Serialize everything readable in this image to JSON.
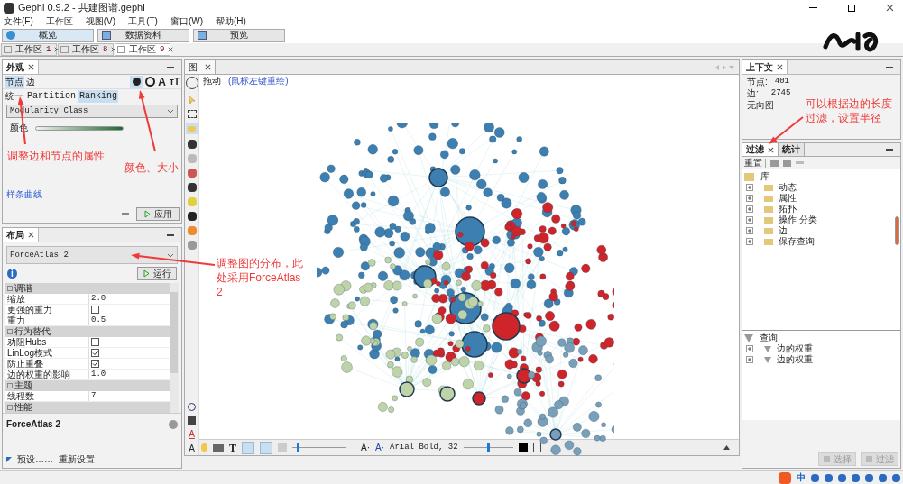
{
  "window": {
    "title": "Gephi 0.9.2 - 共建图谱.gephi"
  },
  "menu": [
    "文件(F)",
    "工作区",
    "视图(V)",
    "工具(T)",
    "窗口(W)",
    "帮助(H)"
  ],
  "modes": [
    {
      "label": "概览",
      "selected": true
    },
    {
      "label": "数据资料",
      "selected": false
    },
    {
      "label": "预览",
      "selected": false
    }
  ],
  "workspace_tabs": [
    {
      "label": "工作区",
      "number": "1",
      "selected": false
    },
    {
      "label": "工作区",
      "number": "8",
      "selected": false
    },
    {
      "label": "工作区",
      "number": "9",
      "selected": true
    }
  ],
  "appearance": {
    "title": "外观",
    "tabs": [
      {
        "label": "节点",
        "selected": true
      },
      {
        "label": "边",
        "selected": false
      }
    ],
    "label_color_glyph": "A",
    "label_size_glyph": "тT",
    "modes": [
      {
        "label": "统一",
        "selected": false
      },
      {
        "label": "Partition",
        "selected": false
      },
      {
        "label": "Ranking",
        "selected": true
      }
    ],
    "attribute": "Modularity Class",
    "color_label": "颜色",
    "spline_link": "样条曲线",
    "apply": "应用"
  },
  "layout": {
    "title": "布局",
    "algorithm": "ForceAtlas 2",
    "info_glyph": "i",
    "run": "运行",
    "sections": [
      {
        "title": "调谐",
        "rows": [
          {
            "kind": "text",
            "label": "缩放",
            "value": "2.0"
          },
          {
            "kind": "check",
            "label": "更强的重力",
            "checked": false
          },
          {
            "kind": "text",
            "label": "重力",
            "value": "0.5"
          }
        ]
      },
      {
        "title": "行为替代",
        "rows": [
          {
            "kind": "check",
            "label": "劝阻Hubs",
            "checked": false
          },
          {
            "kind": "check",
            "label": "LinLog模式",
            "checked": true
          },
          {
            "kind": "check",
            "label": "防止重叠",
            "checked": true
          },
          {
            "kind": "text",
            "label": "边的权重的影响",
            "value": "1.0"
          }
        ]
      },
      {
        "title": "主题",
        "rows": [
          {
            "kind": "text",
            "label": "线程数",
            "value": "7"
          }
        ]
      },
      {
        "title": "性能"
      }
    ],
    "description": "ForceAtlas 2",
    "presets": "预设……",
    "reset": "重新设置"
  },
  "graph": {
    "title": "图",
    "tool_label": "拖动",
    "tool_hint": "(鼠标左键重绘)",
    "side_glyphs": [
      "A",
      "A"
    ],
    "text_glyph": "T",
    "edge_scale": {
      "level": 0.1
    },
    "font_glyphs": [
      "A·",
      "A·"
    ],
    "font": "Arial Bold, 32",
    "label_size": {
      "level": 0.5
    }
  },
  "context": {
    "title": "上下文",
    "nodes_label": "节点:",
    "nodes": "401",
    "edges_label": "边:",
    "edges": "2745",
    "type": "无向图"
  },
  "filters": {
    "tabs": [
      {
        "label": "过滤",
        "selected": true
      },
      {
        "label": "统计",
        "selected": false
      }
    ],
    "reset": "重置",
    "library": {
      "label": "库",
      "children": [
        {
          "label": "动态"
        },
        {
          "label": "属性"
        },
        {
          "label": "拓扑"
        },
        {
          "label": "操作 分类"
        },
        {
          "label": "边"
        },
        {
          "label": "保存查询"
        }
      ]
    },
    "queries": {
      "label": "查询",
      "children": [
        {
          "label": "边的权重"
        },
        {
          "label": "边的权重"
        }
      ]
    },
    "buttons": [
      {
        "label": "选择",
        "disabled": true
      },
      {
        "label": "过滤",
        "disabled": true
      }
    ]
  },
  "annotations": [
    "调整边和节点的属性",
    "颜色、大小",
    "调整图的分布，此处采用ForceAtlas 2",
    "可以根据边的长度过滤，设置半径"
  ],
  "tray": {
    "ime": "中"
  }
}
